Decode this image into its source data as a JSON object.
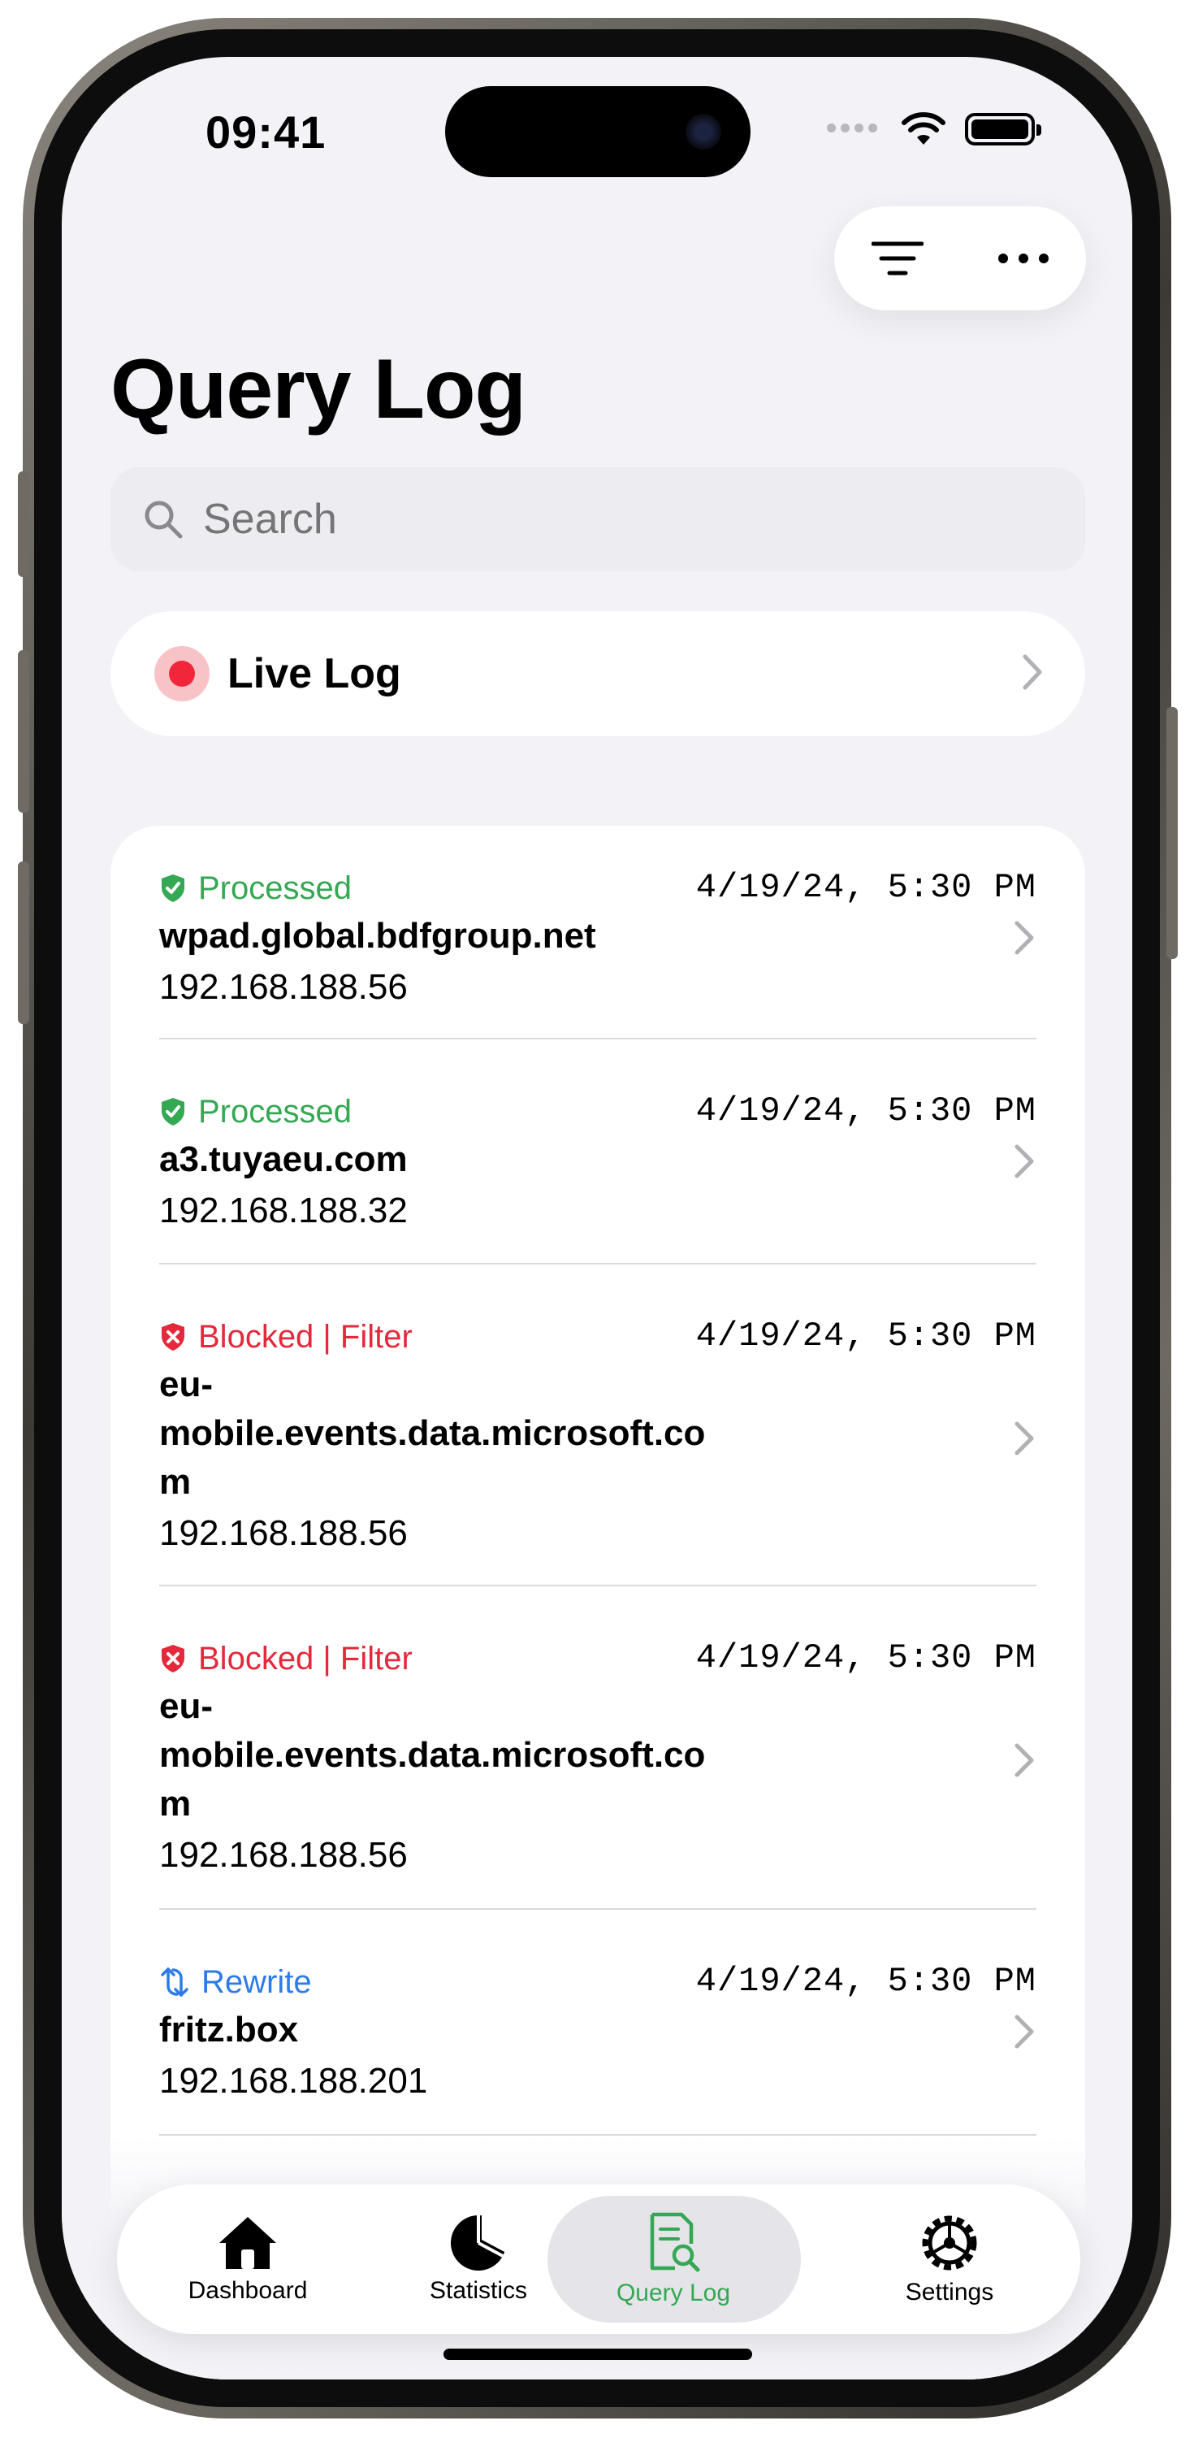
{
  "status_bar": {
    "time": "09:41"
  },
  "search": {
    "placeholder": "Search"
  },
  "header": {
    "title": "Query Log"
  },
  "live_log": {
    "label": "Live Log"
  },
  "entries": [
    {
      "status": "Processed",
      "type": "processed",
      "time": "4/19/24, 5:30 PM",
      "domain": "wpad.global.bdfgroup.net",
      "ip": "192.168.188.56"
    },
    {
      "status": "Processed",
      "type": "processed",
      "time": "4/19/24, 5:30 PM",
      "domain": "a3.tuyaeu.com",
      "ip": "192.168.188.32"
    },
    {
      "status": "Blocked | Filter",
      "type": "blocked",
      "time": "4/19/24, 5:30 PM",
      "domain": "eu-mobile.events.data.microsoft.com",
      "ip": "192.168.188.56"
    },
    {
      "status": "Blocked | Filter",
      "type": "blocked",
      "time": "4/19/24, 5:30 PM",
      "domain": "eu-mobile.events.data.microsoft.com",
      "ip": "192.168.188.56"
    },
    {
      "status": "Rewrite",
      "type": "rewrite",
      "time": "4/19/24, 5:30 PM",
      "domain": "fritz.box",
      "ip": "192.168.188.201"
    }
  ],
  "tabs": [
    {
      "label": "Dashboard",
      "icon": "house-icon"
    },
    {
      "label": "Statistics",
      "icon": "pie-chart-icon"
    },
    {
      "label": "Query Log",
      "icon": "document-search-icon",
      "active": true
    },
    {
      "label": "Settings",
      "icon": "gear-icon"
    }
  ],
  "colors": {
    "processed": "#34a853",
    "blocked": "#e5283b",
    "rewrite": "#2f7be5",
    "live": "#f1263a"
  }
}
